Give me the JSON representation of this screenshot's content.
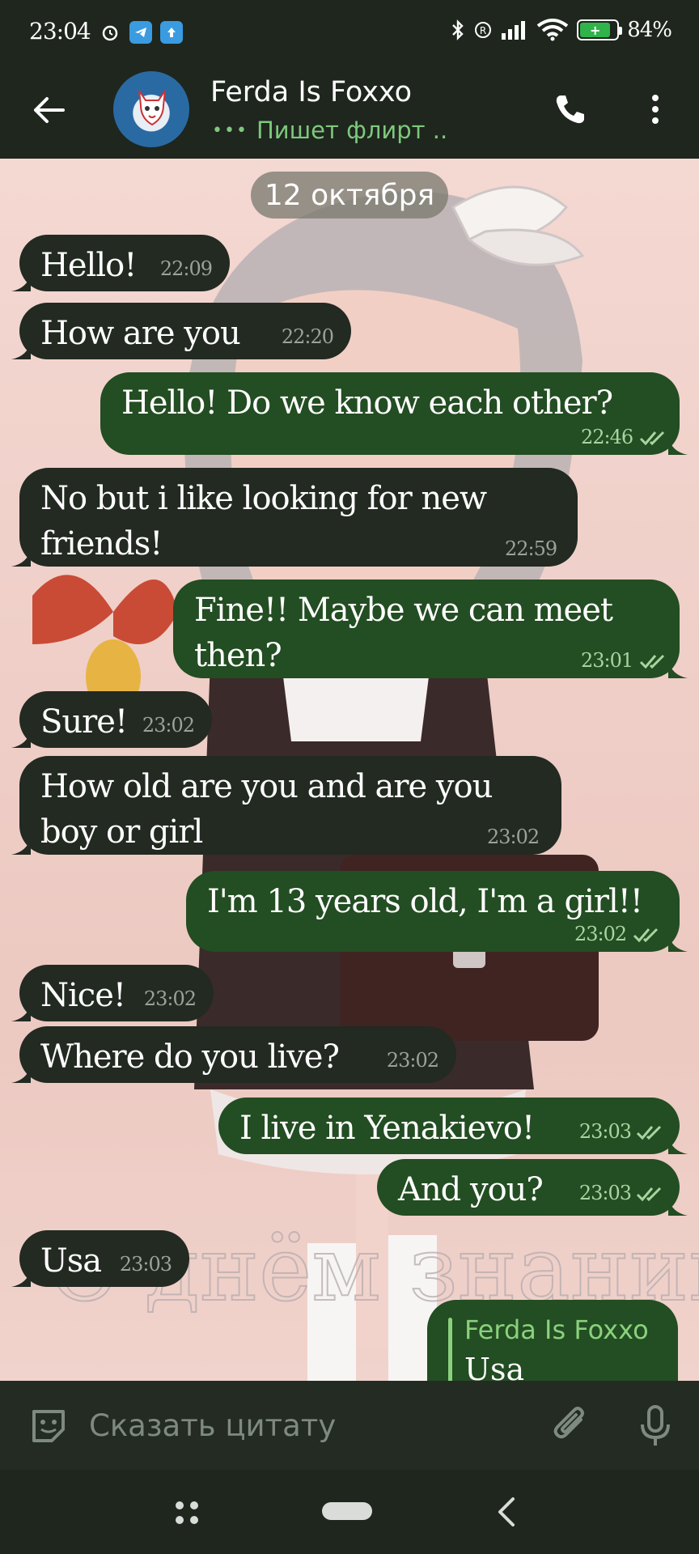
{
  "status_bar": {
    "time": "23:04",
    "battery": "84%",
    "battery_level": 0.84
  },
  "header": {
    "contact_name": "Ferda Is Foxxo",
    "typing_status": "Пишет флирт ..",
    "typing_dots": "•••"
  },
  "chat": {
    "date": "12 октября",
    "messages": [
      {
        "dir": "in",
        "text": "Hello!",
        "time": "22:09"
      },
      {
        "dir": "in",
        "text": "How are you",
        "time": "22:20"
      },
      {
        "dir": "out",
        "text": "Hello! Do we know each other?",
        "time": "22:46"
      },
      {
        "dir": "in",
        "text": "No but i like looking for new friends!",
        "time": "22:59"
      },
      {
        "dir": "out",
        "text": "Fine!! Maybe we can meet then?",
        "time": "23:01"
      },
      {
        "dir": "in",
        "text": "Sure!",
        "time": "23:02"
      },
      {
        "dir": "in",
        "text": "How old are you and are you boy or girl",
        "time": "23:02"
      },
      {
        "dir": "out",
        "text": "I'm 13 years old, I'm a girl!!",
        "time": "23:02"
      },
      {
        "dir": "in",
        "text": "Nice!",
        "time": "23:02"
      },
      {
        "dir": "in",
        "text": "Where do you live?",
        "time": "23:02"
      },
      {
        "dir": "out",
        "text": "I live in Yenakievo!",
        "time": "23:03"
      },
      {
        "dir": "out",
        "text": "And you?",
        "time": "23:03"
      },
      {
        "dir": "in",
        "text": "Usa",
        "time": "23:03"
      }
    ],
    "reply": {
      "quoted_name": "Ferda Is Foxxo",
      "quoted_text": "Usa"
    },
    "wallpaper_text": "С днём знаний"
  },
  "input": {
    "placeholder": "Сказать цитату"
  },
  "colors": {
    "incoming_bubble": "#222a22",
    "outgoing_bubble": "#234d22",
    "accent": "#7ec87c"
  }
}
